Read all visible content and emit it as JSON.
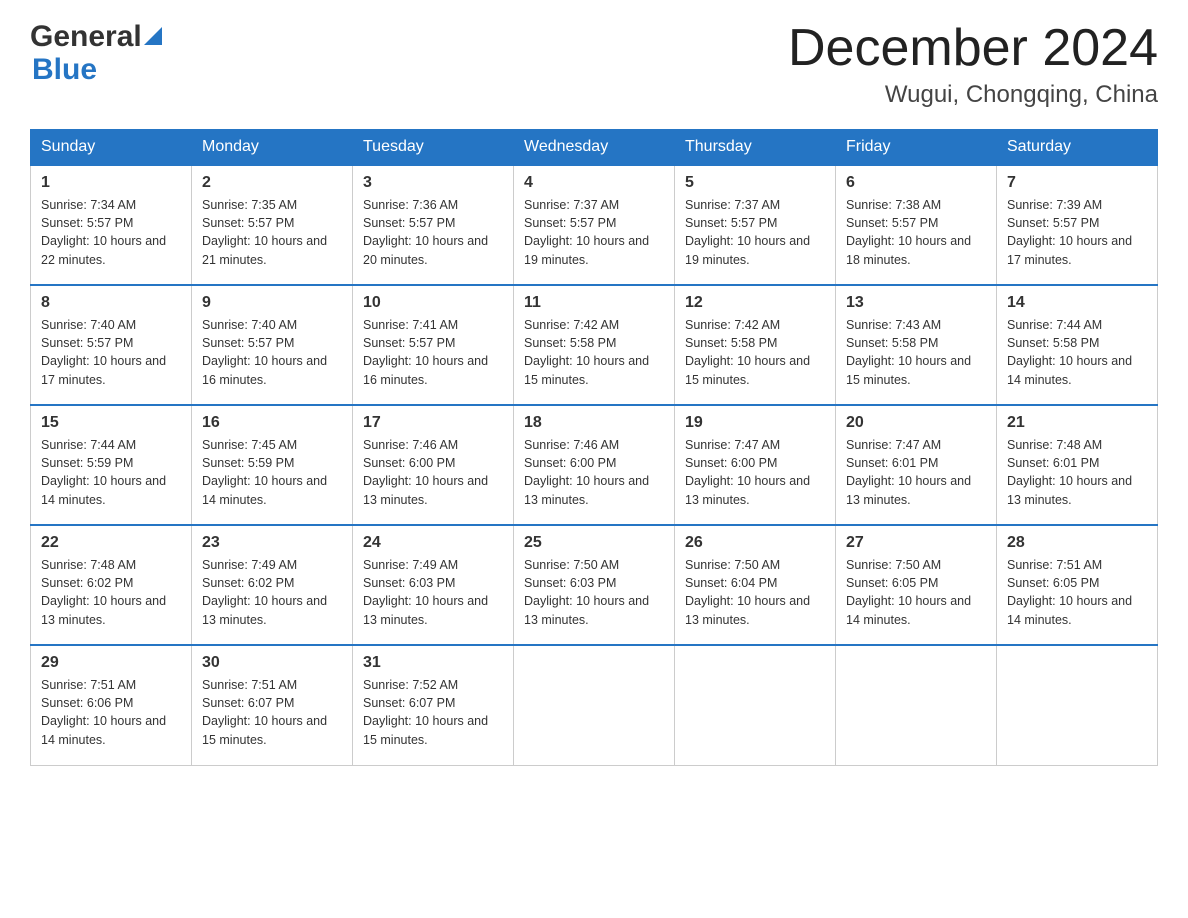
{
  "header": {
    "month_title": "December 2024",
    "location": "Wugui, Chongqing, China"
  },
  "logo": {
    "general": "General",
    "blue": "Blue"
  },
  "days_of_week": [
    "Sunday",
    "Monday",
    "Tuesday",
    "Wednesday",
    "Thursday",
    "Friday",
    "Saturday"
  ],
  "weeks": [
    [
      {
        "day": "1",
        "sunrise": "7:34 AM",
        "sunset": "5:57 PM",
        "daylight": "10 hours and 22 minutes."
      },
      {
        "day": "2",
        "sunrise": "7:35 AM",
        "sunset": "5:57 PM",
        "daylight": "10 hours and 21 minutes."
      },
      {
        "day": "3",
        "sunrise": "7:36 AM",
        "sunset": "5:57 PM",
        "daylight": "10 hours and 20 minutes."
      },
      {
        "day": "4",
        "sunrise": "7:37 AM",
        "sunset": "5:57 PM",
        "daylight": "10 hours and 19 minutes."
      },
      {
        "day": "5",
        "sunrise": "7:37 AM",
        "sunset": "5:57 PM",
        "daylight": "10 hours and 19 minutes."
      },
      {
        "day": "6",
        "sunrise": "7:38 AM",
        "sunset": "5:57 PM",
        "daylight": "10 hours and 18 minutes."
      },
      {
        "day": "7",
        "sunrise": "7:39 AM",
        "sunset": "5:57 PM",
        "daylight": "10 hours and 17 minutes."
      }
    ],
    [
      {
        "day": "8",
        "sunrise": "7:40 AM",
        "sunset": "5:57 PM",
        "daylight": "10 hours and 17 minutes."
      },
      {
        "day": "9",
        "sunrise": "7:40 AM",
        "sunset": "5:57 PM",
        "daylight": "10 hours and 16 minutes."
      },
      {
        "day": "10",
        "sunrise": "7:41 AM",
        "sunset": "5:57 PM",
        "daylight": "10 hours and 16 minutes."
      },
      {
        "day": "11",
        "sunrise": "7:42 AM",
        "sunset": "5:58 PM",
        "daylight": "10 hours and 15 minutes."
      },
      {
        "day": "12",
        "sunrise": "7:42 AM",
        "sunset": "5:58 PM",
        "daylight": "10 hours and 15 minutes."
      },
      {
        "day": "13",
        "sunrise": "7:43 AM",
        "sunset": "5:58 PM",
        "daylight": "10 hours and 15 minutes."
      },
      {
        "day": "14",
        "sunrise": "7:44 AM",
        "sunset": "5:58 PM",
        "daylight": "10 hours and 14 minutes."
      }
    ],
    [
      {
        "day": "15",
        "sunrise": "7:44 AM",
        "sunset": "5:59 PM",
        "daylight": "10 hours and 14 minutes."
      },
      {
        "day": "16",
        "sunrise": "7:45 AM",
        "sunset": "5:59 PM",
        "daylight": "10 hours and 14 minutes."
      },
      {
        "day": "17",
        "sunrise": "7:46 AM",
        "sunset": "6:00 PM",
        "daylight": "10 hours and 13 minutes."
      },
      {
        "day": "18",
        "sunrise": "7:46 AM",
        "sunset": "6:00 PM",
        "daylight": "10 hours and 13 minutes."
      },
      {
        "day": "19",
        "sunrise": "7:47 AM",
        "sunset": "6:00 PM",
        "daylight": "10 hours and 13 minutes."
      },
      {
        "day": "20",
        "sunrise": "7:47 AM",
        "sunset": "6:01 PM",
        "daylight": "10 hours and 13 minutes."
      },
      {
        "day": "21",
        "sunrise": "7:48 AM",
        "sunset": "6:01 PM",
        "daylight": "10 hours and 13 minutes."
      }
    ],
    [
      {
        "day": "22",
        "sunrise": "7:48 AM",
        "sunset": "6:02 PM",
        "daylight": "10 hours and 13 minutes."
      },
      {
        "day": "23",
        "sunrise": "7:49 AM",
        "sunset": "6:02 PM",
        "daylight": "10 hours and 13 minutes."
      },
      {
        "day": "24",
        "sunrise": "7:49 AM",
        "sunset": "6:03 PM",
        "daylight": "10 hours and 13 minutes."
      },
      {
        "day": "25",
        "sunrise": "7:50 AM",
        "sunset": "6:03 PM",
        "daylight": "10 hours and 13 minutes."
      },
      {
        "day": "26",
        "sunrise": "7:50 AM",
        "sunset": "6:04 PM",
        "daylight": "10 hours and 13 minutes."
      },
      {
        "day": "27",
        "sunrise": "7:50 AM",
        "sunset": "6:05 PM",
        "daylight": "10 hours and 14 minutes."
      },
      {
        "day": "28",
        "sunrise": "7:51 AM",
        "sunset": "6:05 PM",
        "daylight": "10 hours and 14 minutes."
      }
    ],
    [
      {
        "day": "29",
        "sunrise": "7:51 AM",
        "sunset": "6:06 PM",
        "daylight": "10 hours and 14 minutes."
      },
      {
        "day": "30",
        "sunrise": "7:51 AM",
        "sunset": "6:07 PM",
        "daylight": "10 hours and 15 minutes."
      },
      {
        "day": "31",
        "sunrise": "7:52 AM",
        "sunset": "6:07 PM",
        "daylight": "10 hours and 15 minutes."
      },
      null,
      null,
      null,
      null
    ]
  ]
}
